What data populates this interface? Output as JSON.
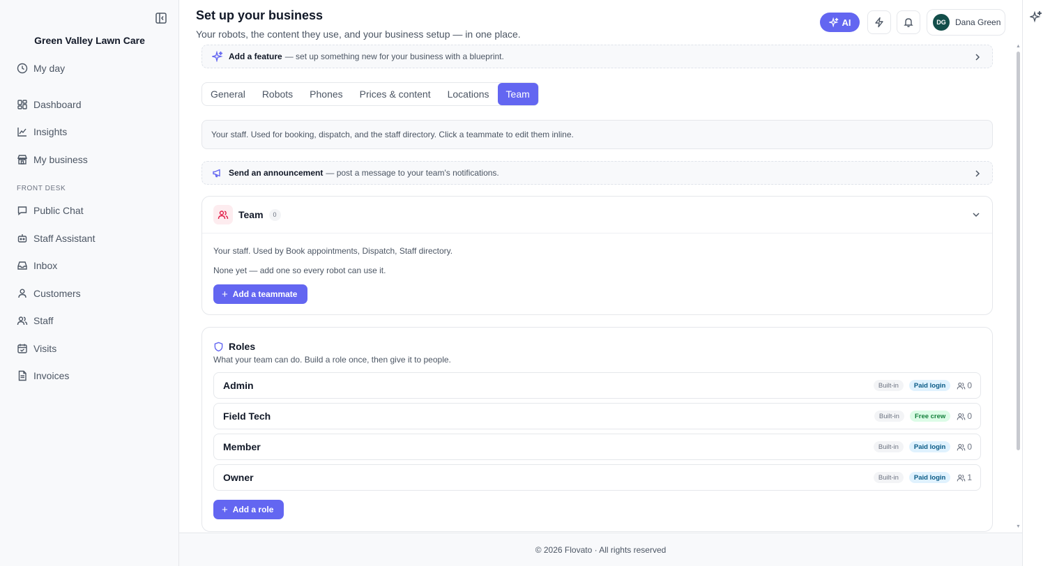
{
  "sidebar": {
    "brand": "Green Valley Lawn Care",
    "items_top": [
      {
        "label": "My day",
        "icon": "clock-icon"
      }
    ],
    "items_main": [
      {
        "label": "Dashboard",
        "icon": "dashboard-icon"
      },
      {
        "label": "Insights",
        "icon": "chart-line-icon"
      },
      {
        "label": "My business",
        "icon": "store-icon"
      }
    ],
    "section_label": "FRONT DESK",
    "items_front_desk": [
      {
        "label": "Public Chat",
        "icon": "chat-bubble-icon"
      },
      {
        "label": "Staff Assistant",
        "icon": "robot-icon"
      },
      {
        "label": "Inbox",
        "icon": "inbox-icon"
      },
      {
        "label": "Customers",
        "icon": "user-icon"
      },
      {
        "label": "Staff",
        "icon": "users-icon"
      },
      {
        "label": "Visits",
        "icon": "calendar-check-icon"
      },
      {
        "label": "Invoices",
        "icon": "document-icon"
      }
    ]
  },
  "header": {
    "title": "Set up your business",
    "subtitle": "Your robots, the content they use, and your business setup — in one place.",
    "ai_label": "AI",
    "user": {
      "initials": "DG",
      "name": "Dana Green",
      "avatar_color": "#134e4a"
    }
  },
  "feature_banner": {
    "bold": "Add a feature",
    "text": "— set up something new for your business with a blueprint."
  },
  "tabs": [
    {
      "label": "General",
      "active": false
    },
    {
      "label": "Robots",
      "active": false
    },
    {
      "label": "Phones",
      "active": false
    },
    {
      "label": "Prices & content",
      "active": false
    },
    {
      "label": "Locations",
      "active": false
    },
    {
      "label": "Team",
      "active": true
    }
  ],
  "info_text": "Your staff. Used for booking, dispatch, and the staff directory. Click a teammate to edit them inline.",
  "announcement_banner": {
    "bold": "Send an announcement",
    "text": "— post a message to your team's notifications."
  },
  "team_card": {
    "title": "Team",
    "count": "0",
    "description": "Your staff. Used by Book appointments, Dispatch, Staff directory.",
    "empty_text": "None yet — add one so every robot can use it.",
    "add_button": "Add a teammate"
  },
  "roles_card": {
    "title": "Roles",
    "description": "What your team can do. Build a role once, then give it to people.",
    "roles": [
      {
        "name": "Admin",
        "builtin": "Built-in",
        "login": "Paid login",
        "login_type": "paid",
        "members": "0"
      },
      {
        "name": "Field Tech",
        "builtin": "Built-in",
        "login": "Free crew",
        "login_type": "free",
        "members": "0"
      },
      {
        "name": "Member",
        "builtin": "Built-in",
        "login": "Paid login",
        "login_type": "paid",
        "members": "0"
      },
      {
        "name": "Owner",
        "builtin": "Built-in",
        "login": "Paid login",
        "login_type": "paid",
        "members": "1"
      }
    ],
    "add_button": "Add a role"
  },
  "footer": "© 2026 Flovato · All rights reserved",
  "colors": {
    "accent": "#6366f1",
    "team_icon": "#e11d48",
    "paid_pill": "#e0f2fe",
    "free_pill": "#dcfce7"
  }
}
